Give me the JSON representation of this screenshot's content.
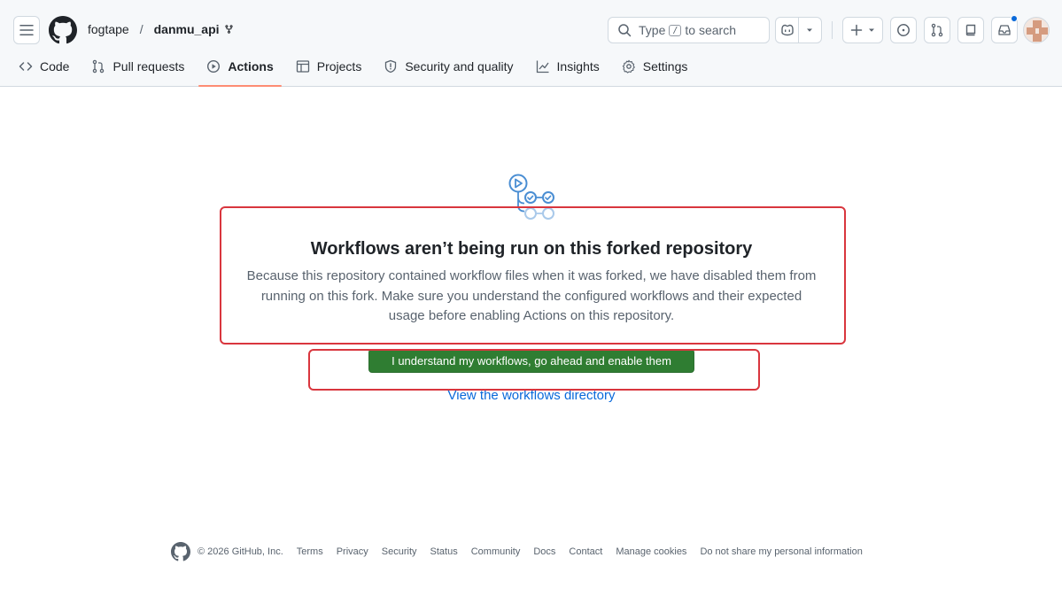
{
  "header": {
    "owner": "fogtape",
    "separator": "/",
    "repo": "danmu_api",
    "search": {
      "prefix": "Type",
      "key": "/",
      "suffix": "to search"
    }
  },
  "tabs": [
    {
      "label": "Code"
    },
    {
      "label": "Pull requests"
    },
    {
      "label": "Actions"
    },
    {
      "label": "Projects"
    },
    {
      "label": "Security and quality"
    },
    {
      "label": "Insights"
    },
    {
      "label": "Settings"
    }
  ],
  "main": {
    "title": "Workflows aren’t being run on this forked repository",
    "description": "Because this repository contained workflow files when it was forked, we have disabled them from running on this fork. Make sure you understand the configured workflows and their expected usage before enabling Actions on this repository.",
    "enable_button": "I understand my workflows, go ahead and enable them",
    "view_link": "View the workflows directory"
  },
  "footer": {
    "copyright": "© 2026 GitHub, Inc.",
    "links": [
      "Terms",
      "Privacy",
      "Security",
      "Status",
      "Community",
      "Docs",
      "Contact",
      "Manage cookies",
      "Do not share my personal information"
    ]
  },
  "colors": {
    "accent": "#0969da",
    "primary_button": "#2f7d32",
    "active_tab_underline": "#fd8c73",
    "highlight_box": "#d9363e"
  }
}
